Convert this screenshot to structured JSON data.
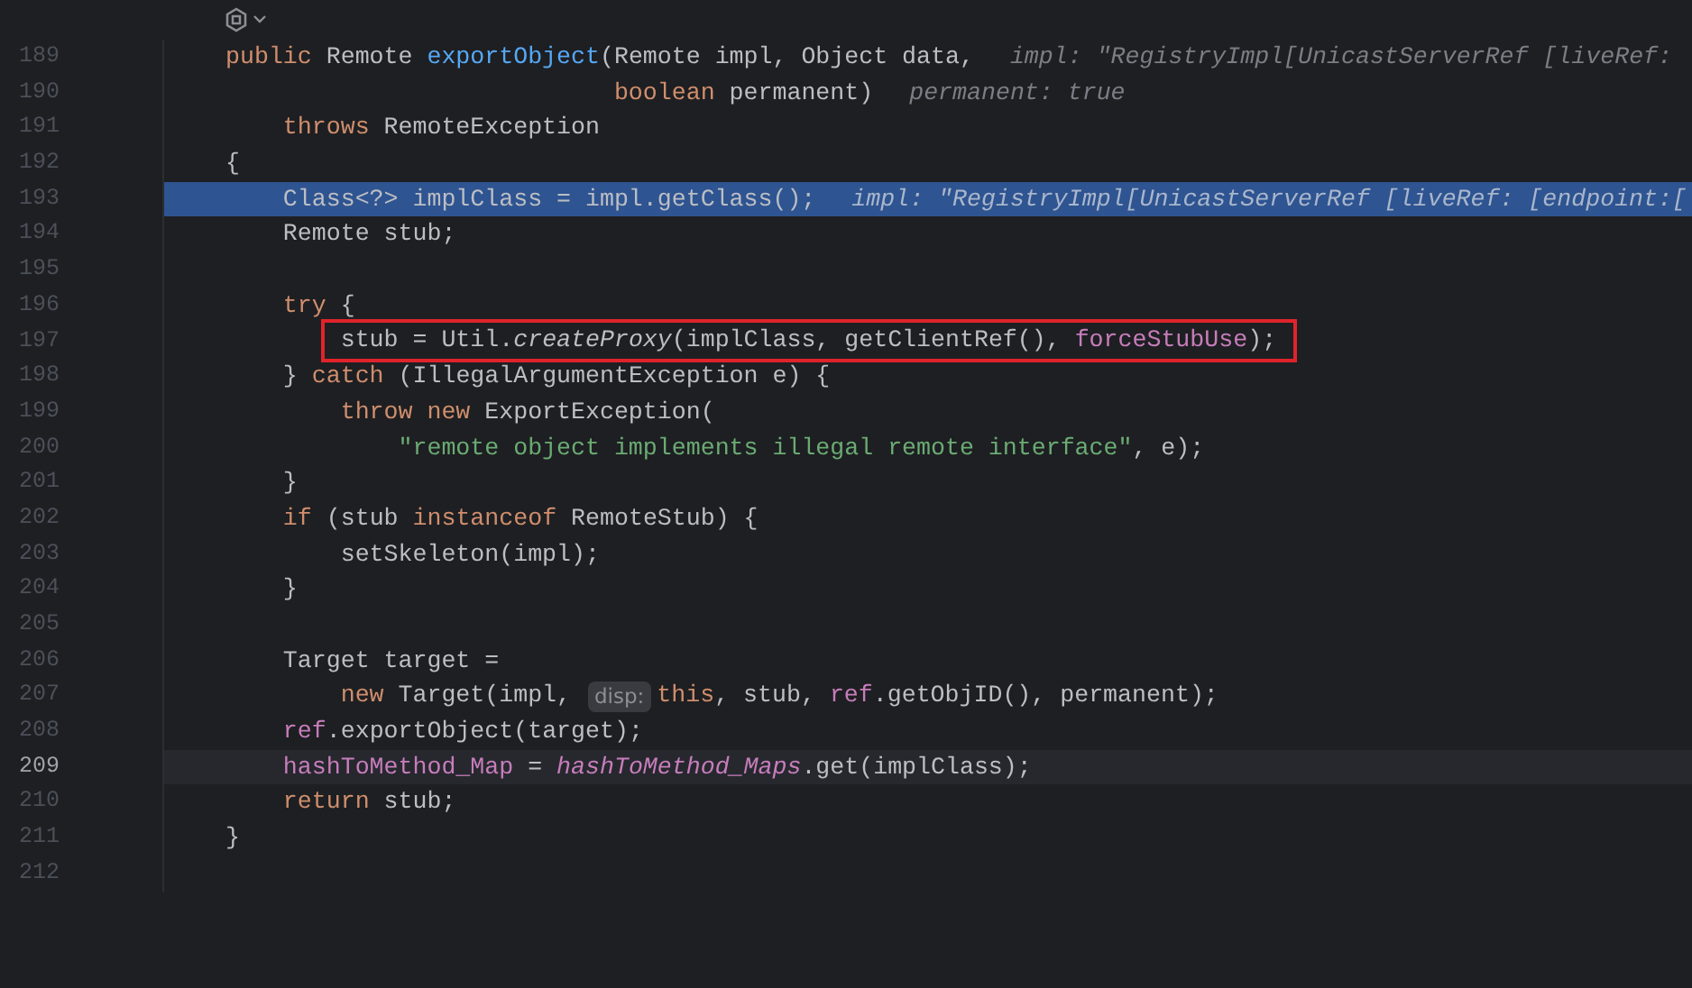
{
  "editor": {
    "lines": [
      {
        "number": "189",
        "execution": false,
        "caret": false,
        "boxed": false,
        "tokens": [
          {
            "text": "public ",
            "kind": "keyword"
          },
          {
            "text": "Remote ",
            "kind": "plain"
          },
          {
            "text": "exportObject",
            "kind": "declaration"
          },
          {
            "text": "(Remote impl, Object data,",
            "kind": "plain"
          }
        ],
        "hint": "impl: \"RegistryImpl[UnicastServerRef [liveRef:"
      },
      {
        "number": "190",
        "execution": false,
        "caret": false,
        "boxed": false,
        "tokens": [
          {
            "text": "                           boolean ",
            "kind": "keyword"
          },
          {
            "text": "permanent)",
            "kind": "plain"
          }
        ],
        "hint": "permanent: true"
      },
      {
        "number": "191",
        "execution": false,
        "caret": false,
        "boxed": false,
        "tokens": [
          {
            "text": "    throws ",
            "kind": "keyword"
          },
          {
            "text": "RemoteException",
            "kind": "plain"
          }
        ]
      },
      {
        "number": "192",
        "execution": false,
        "caret": false,
        "boxed": false,
        "tokens": [
          {
            "text": "{",
            "kind": "plain"
          }
        ]
      },
      {
        "number": "193",
        "execution": true,
        "caret": false,
        "boxed": false,
        "tokens": [
          {
            "text": "    Class<?> implClass = impl.getClass();",
            "kind": "plain"
          }
        ],
        "hint": "impl: \"RegistryImpl[UnicastServerRef [liveRef: [endpoint:["
      },
      {
        "number": "194",
        "execution": false,
        "caret": false,
        "boxed": false,
        "tokens": [
          {
            "text": "    Remote stub;",
            "kind": "plain"
          }
        ]
      },
      {
        "number": "195",
        "execution": false,
        "caret": false,
        "boxed": false
      },
      {
        "number": "196",
        "execution": false,
        "caret": false,
        "boxed": false,
        "tokens": [
          {
            "text": "    try ",
            "kind": "keyword"
          },
          {
            "text": "{",
            "kind": "plain"
          }
        ]
      },
      {
        "number": "197",
        "execution": false,
        "caret": false,
        "boxed": true,
        "tokens": [
          {
            "text": "        stub = Util.",
            "kind": "plain"
          },
          {
            "text": "createProxy",
            "kind": "static-method"
          },
          {
            "text": "(implClass, getClientRef(), ",
            "kind": "plain"
          },
          {
            "text": "forceStubUse",
            "kind": "field"
          },
          {
            "text": ");",
            "kind": "plain"
          }
        ]
      },
      {
        "number": "198",
        "execution": false,
        "caret": false,
        "boxed": false,
        "tokens": [
          {
            "text": "    } ",
            "kind": "plain"
          },
          {
            "text": "catch ",
            "kind": "keyword"
          },
          {
            "text": "(IllegalArgumentException e) {",
            "kind": "plain"
          }
        ]
      },
      {
        "number": "199",
        "execution": false,
        "caret": false,
        "boxed": false,
        "tokens": [
          {
            "text": "        throw new ",
            "kind": "keyword"
          },
          {
            "text": "ExportException(",
            "kind": "plain"
          }
        ]
      },
      {
        "number": "200",
        "execution": false,
        "caret": false,
        "boxed": false,
        "tokens": [
          {
            "text": "            \"remote object implements illegal remote interface\"",
            "kind": "string"
          },
          {
            "text": ", e);",
            "kind": "plain"
          }
        ]
      },
      {
        "number": "201",
        "execution": false,
        "caret": false,
        "boxed": false,
        "tokens": [
          {
            "text": "    }",
            "kind": "plain"
          }
        ]
      },
      {
        "number": "202",
        "execution": false,
        "caret": false,
        "boxed": false,
        "tokens": [
          {
            "text": "    if ",
            "kind": "keyword"
          },
          {
            "text": "(stub ",
            "kind": "plain"
          },
          {
            "text": "instanceof ",
            "kind": "keyword"
          },
          {
            "text": "RemoteStub) {",
            "kind": "plain"
          }
        ]
      },
      {
        "number": "203",
        "execution": false,
        "caret": false,
        "boxed": false,
        "tokens": [
          {
            "text": "        setSkeleton(impl);",
            "kind": "plain"
          }
        ]
      },
      {
        "number": "204",
        "execution": false,
        "caret": false,
        "boxed": false,
        "tokens": [
          {
            "text": "    }",
            "kind": "plain"
          }
        ]
      },
      {
        "number": "205",
        "execution": false,
        "caret": false,
        "boxed": false
      },
      {
        "number": "206",
        "execution": false,
        "caret": false,
        "boxed": false,
        "tokens": [
          {
            "text": "    Target target =",
            "kind": "plain"
          }
        ]
      },
      {
        "number": "207",
        "execution": false,
        "caret": false,
        "boxed": false,
        "tokens": [
          {
            "text": "        new ",
            "kind": "keyword"
          },
          {
            "text": "Target(impl, ",
            "kind": "plain"
          },
          {
            "text": "disp:",
            "kind": "inlay"
          },
          {
            "text": "this",
            "kind": "keyword"
          },
          {
            "text": ", stub, ",
            "kind": "plain"
          },
          {
            "text": "ref",
            "kind": "field"
          },
          {
            "text": ".getObjID(), permanent);",
            "kind": "plain"
          }
        ]
      },
      {
        "number": "208",
        "execution": false,
        "caret": false,
        "boxed": false,
        "tokens": [
          {
            "text": "    ref",
            "kind": "field"
          },
          {
            "text": ".exportObject(target);",
            "kind": "plain"
          }
        ]
      },
      {
        "number": "209",
        "execution": false,
        "caret": true,
        "boxed": false,
        "tokens": [
          {
            "text": "    hashToMethod_Map",
            "kind": "field"
          },
          {
            "text": " = ",
            "kind": "plain"
          },
          {
            "text": "hashToMethod_Maps",
            "kind": "static-field"
          },
          {
            "text": ".get(implClass);",
            "kind": "plain"
          }
        ]
      },
      {
        "number": "210",
        "execution": false,
        "caret": false,
        "boxed": false,
        "tokens": [
          {
            "text": "    return ",
            "kind": "keyword"
          },
          {
            "text": "stub;",
            "kind": "plain"
          }
        ]
      },
      {
        "number": "211",
        "execution": false,
        "caret": false,
        "boxed": false,
        "tokens": [
          {
            "text": "}",
            "kind": "plain"
          }
        ]
      },
      {
        "number": "212",
        "execution": false,
        "caret": false,
        "boxed": false
      }
    ]
  }
}
